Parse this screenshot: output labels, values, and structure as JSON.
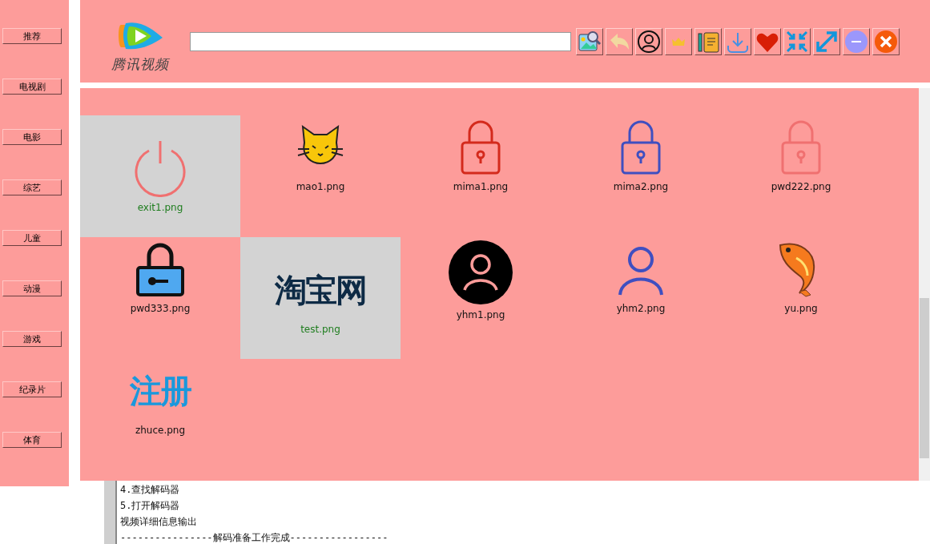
{
  "sidebar": {
    "items": [
      {
        "label": "推荐"
      },
      {
        "label": "电视剧"
      },
      {
        "label": "电影"
      },
      {
        "label": "综艺"
      },
      {
        "label": "儿童"
      },
      {
        "label": "动漫"
      },
      {
        "label": "游戏"
      },
      {
        "label": "纪录片"
      },
      {
        "label": "体育"
      }
    ]
  },
  "header": {
    "logo_text": "腾讯视频",
    "tools": [
      {
        "kind": "image-search"
      },
      {
        "kind": "back"
      },
      {
        "kind": "user"
      },
      {
        "kind": "crown"
      },
      {
        "kind": "notes"
      },
      {
        "kind": "download"
      },
      {
        "kind": "heart"
      },
      {
        "kind": "shrink"
      },
      {
        "kind": "expand"
      },
      {
        "kind": "minimize"
      },
      {
        "kind": "close"
      }
    ]
  },
  "grid": {
    "items": [
      {
        "name": "exit1.png",
        "kind": "power",
        "selected": true
      },
      {
        "name": "mao1.png",
        "kind": "cat",
        "selected": false
      },
      {
        "name": "mima1.png",
        "kind": "lock",
        "color": "#d42a1c",
        "selected": false
      },
      {
        "name": "mima2.png",
        "kind": "lock",
        "color": "#3f4fc0",
        "selected": false
      },
      {
        "name": "pwd222.png",
        "kind": "lock",
        "color": "#f07070",
        "selected": false
      },
      {
        "name": "pwd333.png",
        "kind": "keylock",
        "selected": false
      },
      {
        "name": "test.png",
        "kind": "wordmark",
        "art_text": "淘宝网",
        "selected": true
      },
      {
        "name": "yhm1.png",
        "kind": "user-dark",
        "selected": false
      },
      {
        "name": "yhm2.png",
        "kind": "user",
        "selected": false
      },
      {
        "name": "yu.png",
        "kind": "fish",
        "selected": false
      },
      {
        "name": "zhuce.png",
        "kind": "wordmark-blue",
        "art_text": "注册",
        "selected": false
      }
    ]
  },
  "console": {
    "lines": [
      "4.查找解码器",
      "5.打开解码器",
      "视频详细信息输出",
      "----------------解码准备工作完成-----------------"
    ]
  }
}
